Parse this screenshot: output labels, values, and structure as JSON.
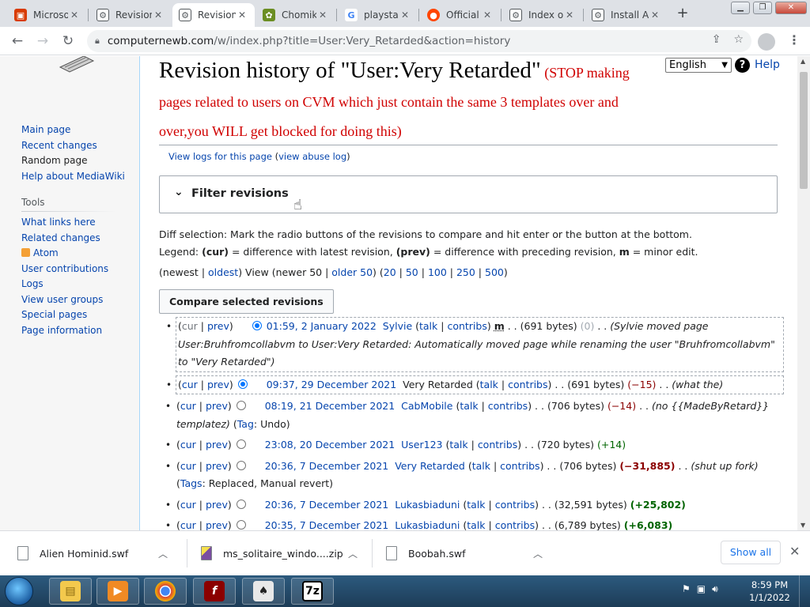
{
  "browser": {
    "tabs": [
      {
        "title": "Microsoft",
        "icon": "M",
        "color": "#d83b01"
      },
      {
        "title": "Revision",
        "icon": "W",
        "color": "#54595d"
      },
      {
        "title": "Revision",
        "icon": "W",
        "color": "#54595d"
      },
      {
        "title": "Chomik",
        "icon": "C",
        "color": "#6b8e23"
      },
      {
        "title": "playsta",
        "icon": "G",
        "color": "#4285f4"
      },
      {
        "title": "Official",
        "icon": "r",
        "color": "#ff4500"
      },
      {
        "title": "Index o",
        "icon": "W",
        "color": "#54595d"
      },
      {
        "title": "Install A",
        "icon": "W",
        "color": "#54595d"
      }
    ],
    "url_host": "computernewb.com",
    "url_path": "/w/index.php?title=User:Very_Retarded&action=history"
  },
  "sidebar": {
    "nav": [
      "Main page",
      "Recent changes",
      "Random page",
      "Help about MediaWiki"
    ],
    "tools_heading": "Tools",
    "tools": [
      "What links here",
      "Related changes",
      "Atom",
      "User contributions",
      "Logs",
      "View user groups",
      "Special pages",
      "Page information"
    ]
  },
  "header": {
    "language": "English",
    "help": "Help",
    "title": "Revision history of \"User:Very Retarded\"",
    "warning": " (STOP making pages related to users on CVM which just contain the same 3 templates over and over,you WILL get blocked for doing this)",
    "view_logs": "View logs for this page",
    "abuse_log": "view abuse log"
  },
  "filter": {
    "label": "Filter revisions"
  },
  "diffsel": {
    "line1": "Diff selection: Mark the radio buttons of the revisions to compare and hit enter or the button at the bottom.",
    "legend_prefix": "Legend: ",
    "cur": "(cur)",
    "cur_desc": " = difference with latest revision, ",
    "prev": "(prev)",
    "prev_desc": " = difference with preceding revision, ",
    "m": "m",
    "m_desc": " = minor edit."
  },
  "pager": {
    "newest": "newest",
    "oldest": "oldest",
    "view": " View (newer 50 | ",
    "older": "older 50",
    "limits": [
      "20",
      "50",
      "100",
      "250",
      "500"
    ]
  },
  "compare_button": "Compare selected revisions",
  "revisions": [
    {
      "date": "01:59, 2 January 2022",
      "user": "Sylvie",
      "size": "(691 bytes)",
      "diff": "(0)",
      "minor": "m",
      "summary": "(Sylvie moved page User:Bruhfromcollabvm to User:Very Retarded: Automatically moved page while renaming the user \"Bruhfromcollabvm\" to \"Very Retarded\")"
    },
    {
      "date": "09:37, 29 December 2021",
      "user": "Very Retarded",
      "size": "(691 bytes)",
      "diff": "(−15)",
      "summary": "(what the)"
    },
    {
      "date": "08:19, 21 December 2021",
      "user": "CabMobile",
      "size": "(706 bytes)",
      "diff": "(−14)",
      "summary": "(no {{MadeByRetard}} templatez)",
      "tag_label": "Tag",
      "tags": "Undo"
    },
    {
      "date": "23:08, 20 December 2021",
      "user": "User123",
      "size": "(720 bytes)",
      "diff": "(+14)"
    },
    {
      "date": "20:36, 7 December 2021",
      "user": "Very Retarded",
      "size": "(706 bytes)",
      "diff": "(−31,885)",
      "summary": "(shut up fork)",
      "tag_label": "Tags",
      "tags": "Replaced, Manual revert"
    },
    {
      "date": "20:36, 7 December 2021",
      "user": "Lukasbiaduni",
      "size": "(32,591 bytes)",
      "diff": "(+25,802)"
    },
    {
      "date": "20:35, 7 December 2021",
      "user": "Lukasbiaduni",
      "size": "(6,789 bytes)",
      "diff": "(+6,083)"
    }
  ],
  "rev_labels": {
    "cur": "cur",
    "prev": "prev",
    "talk": "talk",
    "contribs": "contribs"
  },
  "downloads": [
    {
      "name": "Alien Hominid.swf"
    },
    {
      "name": "ms_solitaire_windo....zip"
    },
    {
      "name": "Boobah.swf"
    }
  ],
  "show_all": "Show all",
  "clock": {
    "time": "8:59 PM",
    "date": "1/1/2022"
  }
}
